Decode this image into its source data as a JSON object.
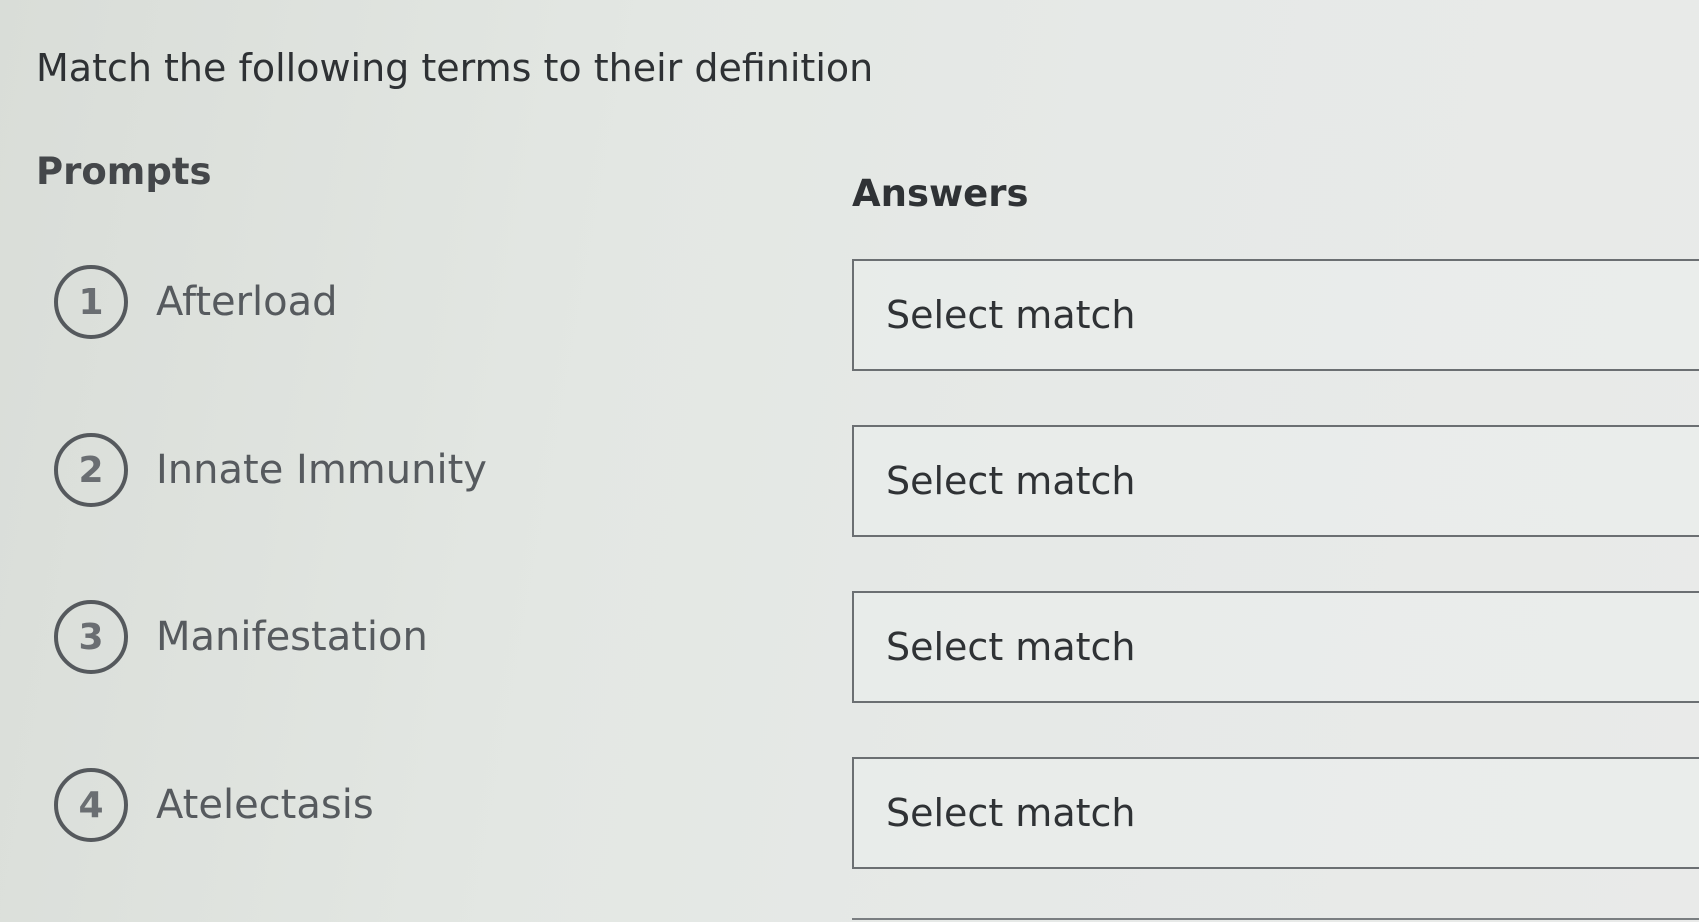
{
  "question": {
    "title": "Match the following terms to their definition"
  },
  "prompts": {
    "heading": "Prompts",
    "items": [
      {
        "number": "1",
        "term": "Afterload"
      },
      {
        "number": "2",
        "term": "Innate Immunity"
      },
      {
        "number": "3",
        "term": "Manifestation"
      },
      {
        "number": "4",
        "term": "Atelectasis"
      }
    ]
  },
  "answers": {
    "heading": "Answers",
    "items": [
      {
        "value": "Select match"
      },
      {
        "value": "Select match"
      },
      {
        "value": "Select match"
      },
      {
        "value": "Select match"
      }
    ]
  }
}
